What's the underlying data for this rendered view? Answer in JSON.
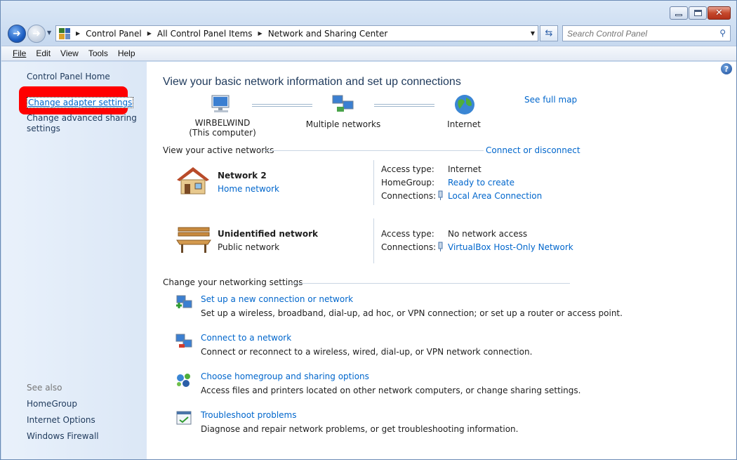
{
  "window": {
    "caption": {
      "minimize": "minimize",
      "maximize": "maximize",
      "close": "✕"
    }
  },
  "address_bar": {
    "crumbs": [
      "Control Panel",
      "All Control Panel Items",
      "Network and Sharing Center"
    ]
  },
  "search": {
    "placeholder": "Search Control Panel"
  },
  "menu": {
    "file": "File",
    "edit": "Edit",
    "view": "View",
    "tools": "Tools",
    "help": "Help"
  },
  "sidebar": {
    "home": "Control Panel Home",
    "change_adapter": "Change adapter settings",
    "change_sharing": "Change advanced sharing settings",
    "see_also": "See also",
    "see_also_items": [
      "HomeGroup",
      "Internet Options",
      "Windows Firewall"
    ]
  },
  "main": {
    "title": "View your basic network information and set up connections",
    "see_full_map": "See full map",
    "map": {
      "computer_name": "WIRBELWIND",
      "computer_sub": "(This computer)",
      "networks": "Multiple networks",
      "internet": "Internet"
    },
    "active_networks_header": "View your active networks",
    "connect_disconnect": "Connect or disconnect",
    "networks": [
      {
        "name": "Network  2",
        "type": "Home network",
        "access_label": "Access type:",
        "access_value": "Internet",
        "homegroup_label": "HomeGroup:",
        "homegroup_value": "Ready to create",
        "connections_label": "Connections:",
        "connections_value": "Local Area Connection"
      },
      {
        "name": "Unidentified network",
        "type": "Public network",
        "access_label": "Access type:",
        "access_value": "No network access",
        "connections_label": "Connections:",
        "connections_value": "VirtualBox Host-Only Network"
      }
    ],
    "change_settings_header": "Change your networking settings",
    "tasks": [
      {
        "link": "Set up a new connection or network",
        "desc": "Set up a wireless, broadband, dial-up, ad hoc, or VPN connection; or set up a router or access point."
      },
      {
        "link": "Connect to a network",
        "desc": "Connect or reconnect to a wireless, wired, dial-up, or VPN network connection."
      },
      {
        "link": "Choose homegroup and sharing options",
        "desc": "Access files and printers located on other network computers, or change sharing settings."
      },
      {
        "link": "Troubleshoot problems",
        "desc": "Diagnose and repair network problems, or get troubleshooting information."
      }
    ]
  },
  "colors": {
    "link": "#0066cc",
    "highlight": "#ff0000",
    "heading": "#1e395b"
  }
}
